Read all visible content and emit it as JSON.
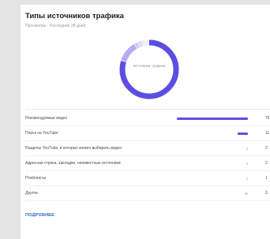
{
  "card": {
    "title": "Типы источников трафика",
    "subtitle": "Просмотры · Последние 28 дней",
    "donut_center": "Источники трафика",
    "more_link": "ПОДРОБНЕЕ"
  },
  "colors": {
    "accent": "#5b4fe0",
    "accent_light": "#b4adf1",
    "link": "#2a61d2"
  },
  "rows": [
    {
      "label": "Рекомендуемые видео",
      "value": "76",
      "share": 0.76
    },
    {
      "label": "Поиск на YouTube",
      "value": "11",
      "share": 0.11
    },
    {
      "label": "Разделы YouTube, в которых можно выбирать видео",
      "value": "2",
      "share": 0.02
    },
    {
      "label": "Адресная строка, закладки, неизвестные источники",
      "value": "2",
      "share": 0.02
    },
    {
      "label": "Плейлисты",
      "value": "1",
      "share": 0.01
    },
    {
      "label": "Другое",
      "value": "3",
      "share": 0.03
    }
  ]
}
